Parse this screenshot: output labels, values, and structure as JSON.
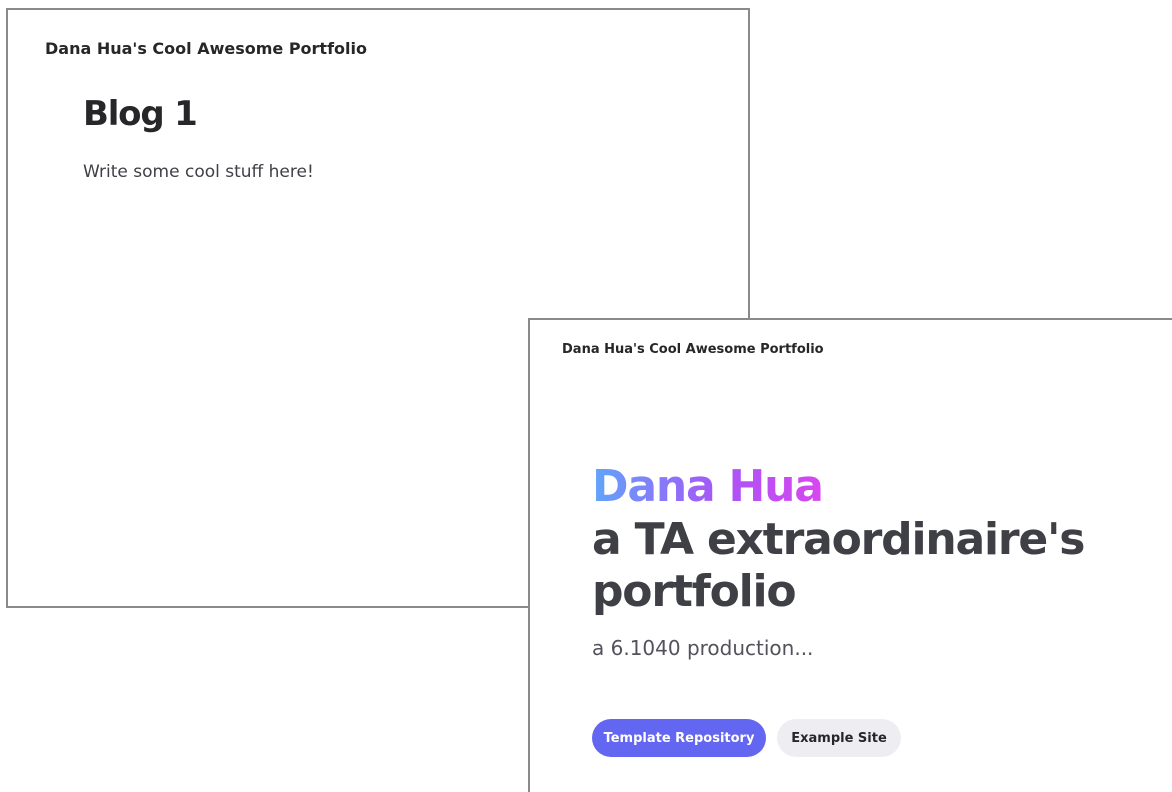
{
  "blog_window": {
    "site_title": "Dana Hua's Cool Awesome Portfolio",
    "heading": "Blog 1",
    "body": "Write some cool stuff here!"
  },
  "home_window": {
    "site_title": "Dana Hua's Cool Awesome Portfolio",
    "hero": {
      "name": "Dana Hua",
      "tagline_line1": "a TA extraordinaire's",
      "tagline_line2": "portfolio",
      "subtitle": "a 6.1040 production..."
    },
    "buttons": {
      "template_repository": "Template Repository",
      "example_site": "Example Site"
    }
  },
  "colors": {
    "gradient_start": "#60a5fa",
    "gradient_mid": "#a855f7",
    "gradient_end": "#d946ef",
    "primary_button": "#6366f1",
    "secondary_button": "#eeeef2",
    "text_dark": "#3f3f46"
  }
}
